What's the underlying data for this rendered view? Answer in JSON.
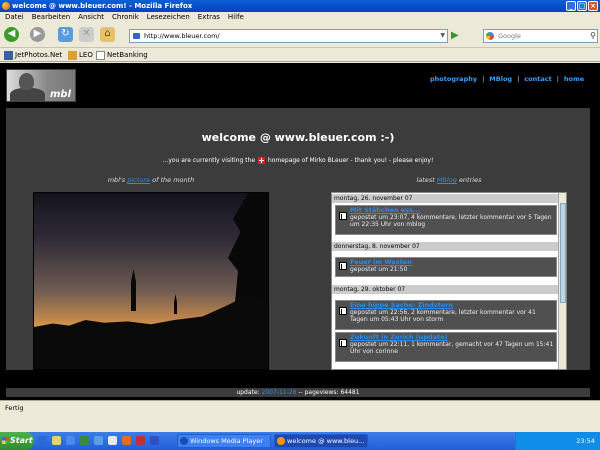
{
  "window": {
    "title": "welcome @ www.bleuer.com! - Mozilla Firefox"
  },
  "menubar": [
    "Datei",
    "Bearbeiten",
    "Ansicht",
    "Chronik",
    "Lesezeichen",
    "Extras",
    "Hilfe"
  ],
  "navbar": {
    "url": "http://www.bleuer.com/",
    "search_placeholder": "Google"
  },
  "bookmarks": [
    "JetPhotos.Net",
    "LEO",
    "NetBanking"
  ],
  "site": {
    "logo_text": "mbl",
    "nav": [
      "photography",
      "MBlog",
      "contact",
      "home"
    ],
    "welcome": "welcome @ www.bleuer.com :-)",
    "sub_before": "...you are currently visiting the",
    "sub_after": "homepage of Mirko BLeuer - thank you! - please enjoy!",
    "left_title_pre": "mbl's",
    "left_title_link": "picture",
    "left_title_post": "of the month",
    "right_title_pre": "latest",
    "right_title_link": "MBlog",
    "right_title_post": "entries",
    "days": [
      {
        "label": "montag, 26. november 07"
      },
      {
        "label": "donnerstag, 8. november 07"
      },
      {
        "label": "montag, 29. oktober 07"
      }
    ],
    "entries": [
      {
        "title": "Mit Stäbchen ess...",
        "meta": "gepostet um 23:07, 4 kommentare, letzter kommentar vor 5 Tagen um 22:35 Uhr von mblog"
      },
      {
        "title": "Feuer im Westen",
        "meta": "gepostet um 21:50"
      },
      {
        "title": "Eine hippe Sache: Zindstern",
        "meta": "gepostet um 22:56, 2 kommentare, letzter kommentar vor 41 Tagen um 05:43 Uhr von storm"
      },
      {
        "title": "Zukunft in Zürich (update)",
        "meta": "gepostet um 22:11, 1 kommentar, gemacht vor 47 Tagen um 15:41 Uhr von corinne"
      }
    ],
    "footer_update_label": "update:",
    "footer_update_value": "2007-11-26",
    "footer_sep": "--",
    "footer_pv_label": "pageviews:",
    "footer_pv_value": "64481"
  },
  "status": "Fertig",
  "taskbar": {
    "start": "Start",
    "tasks": [
      "Windows Media Player",
      "welcome @ www.bleu..."
    ],
    "clock": "23:54"
  }
}
